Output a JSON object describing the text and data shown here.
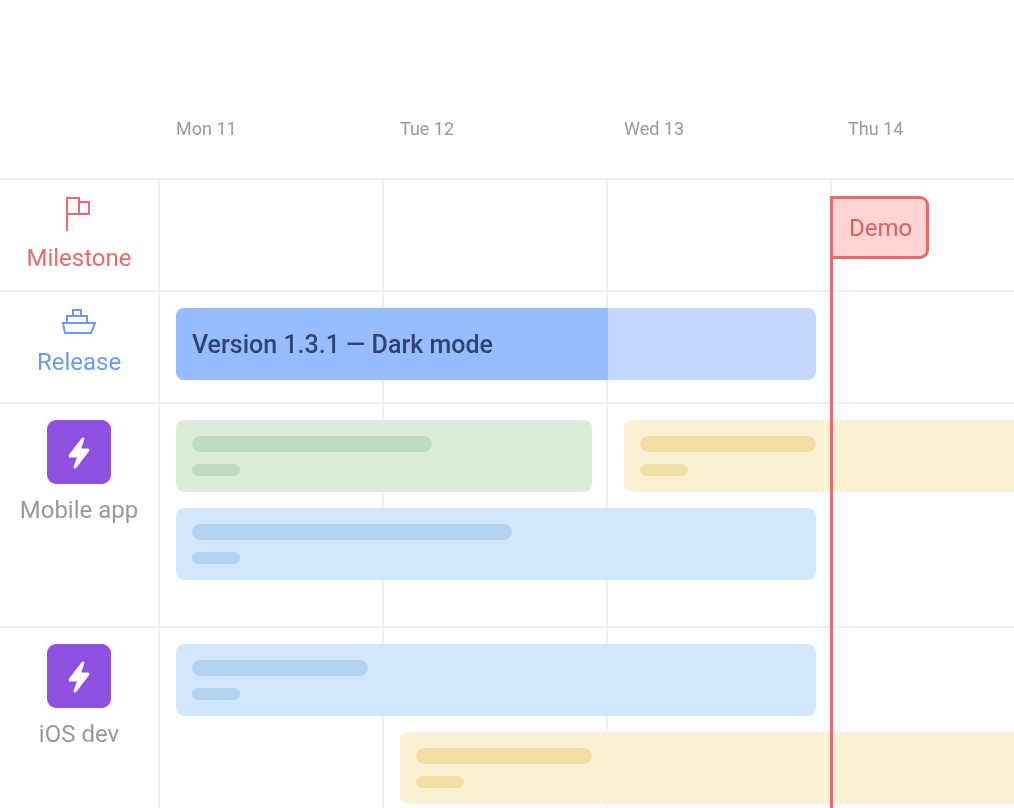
{
  "days": [
    "Mon 11",
    "Tue 12",
    "Wed 13",
    "Thu 14"
  ],
  "today_marker": {
    "label": "Demo"
  },
  "lanes": [
    {
      "kind": "milestone",
      "label": "Milestone"
    },
    {
      "kind": "release",
      "label": "Release",
      "tasks": [
        {
          "kind": "release",
          "title": "Version 1.3.1 — Dark mode",
          "level": 0.675
        }
      ]
    },
    {
      "kind": "team",
      "label": "Mobile app",
      "tasks": [
        {
          "kind": "placeholder",
          "color": "#d9edd9"
        },
        {
          "kind": "placeholder",
          "color": "#fcf1d4"
        },
        {
          "kind": "placeholder",
          "color": "#d3e7fc"
        }
      ]
    },
    {
      "kind": "team",
      "label": "iOS dev",
      "tasks": [
        {
          "kind": "placeholder",
          "color": "#d3e7fc"
        },
        {
          "kind": "placeholder",
          "color": "#fcf1d4"
        }
      ]
    }
  ]
}
